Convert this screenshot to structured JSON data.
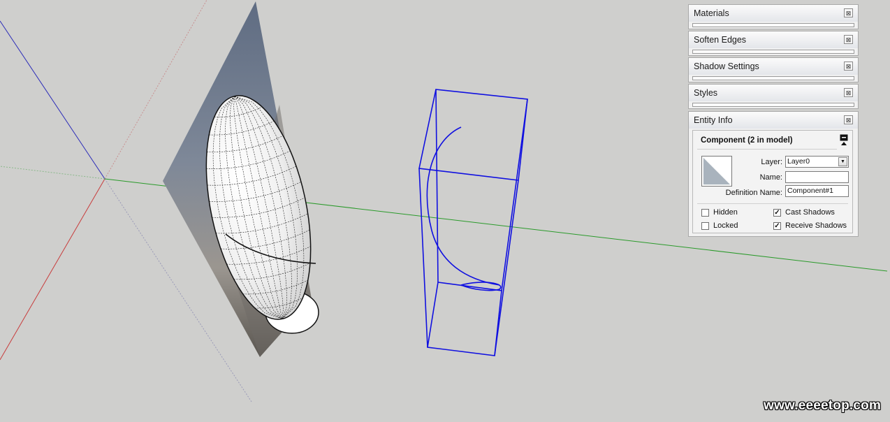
{
  "trays": [
    {
      "title": "Materials"
    },
    {
      "title": "Soften Edges"
    },
    {
      "title": "Shadow Settings"
    },
    {
      "title": "Styles"
    }
  ],
  "entity_info": {
    "title": "Entity Info",
    "component_title": "Component (2 in model)",
    "layer_label": "Layer:",
    "layer_value": "Layer0",
    "name_label": "Name:",
    "name_value": "",
    "definition_label": "Definition Name:",
    "definition_value": "Component#1",
    "hidden_label": "Hidden",
    "hidden_checked": false,
    "locked_label": "Locked",
    "locked_checked": false,
    "cast_shadows_label": "Cast Shadows",
    "cast_shadows_checked": true,
    "receive_shadows_label": "Receive Shadows",
    "receive_shadows_checked": true
  },
  "icons": {
    "close": "close-icon",
    "dropdown": "chevron-down-icon",
    "minimize": "minimize-icon"
  },
  "colors": {
    "selection_blue": "#1010e0",
    "axis_red": "#c83c3c",
    "axis_green": "#2a9a2a",
    "axis_blue": "#2a2ab8"
  },
  "watermark": "www.eeeetop.com"
}
